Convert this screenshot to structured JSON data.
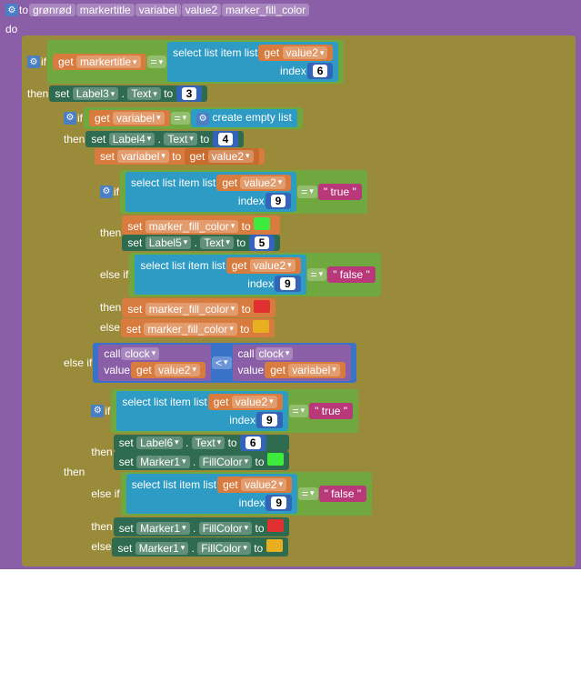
{
  "proc": {
    "to": "to",
    "name": "grønrød",
    "params": [
      "markertitle",
      "variabel",
      "value2",
      "marker_fill_color"
    ],
    "do": "do"
  },
  "kw": {
    "if": "if",
    "then": "then",
    "elseif": "else if",
    "else": "else",
    "set": "set",
    "get": "get",
    "to": "to",
    "call": "call",
    "value": "value"
  },
  "sel": {
    "label": "select list item  list",
    "index": "index"
  },
  "create_empty": "create empty list",
  "ops": {
    "eq": "=",
    "lt": "<"
  },
  "labels": {
    "l3": "Label3",
    "l4": "Label4",
    "l5": "Label5",
    "l6": "Label6",
    "text": "Text",
    "marker1": "Marker1",
    "fillcolor": "FillColor",
    "clock": "clock"
  },
  "vars": {
    "markertitle": "markertitle",
    "variabel": "variabel",
    "value2": "value2",
    "mfc": "marker_fill_color"
  },
  "strs": {
    "true": "\" true \"",
    "false": "\" false \""
  },
  "nums": {
    "n3": "3",
    "n4": "4",
    "n5": "5",
    "n6": "6",
    "n9": "9",
    "i6": "6",
    "i9a": "9",
    "i9b": "9",
    "i9c": "9",
    "i9d": "9"
  }
}
